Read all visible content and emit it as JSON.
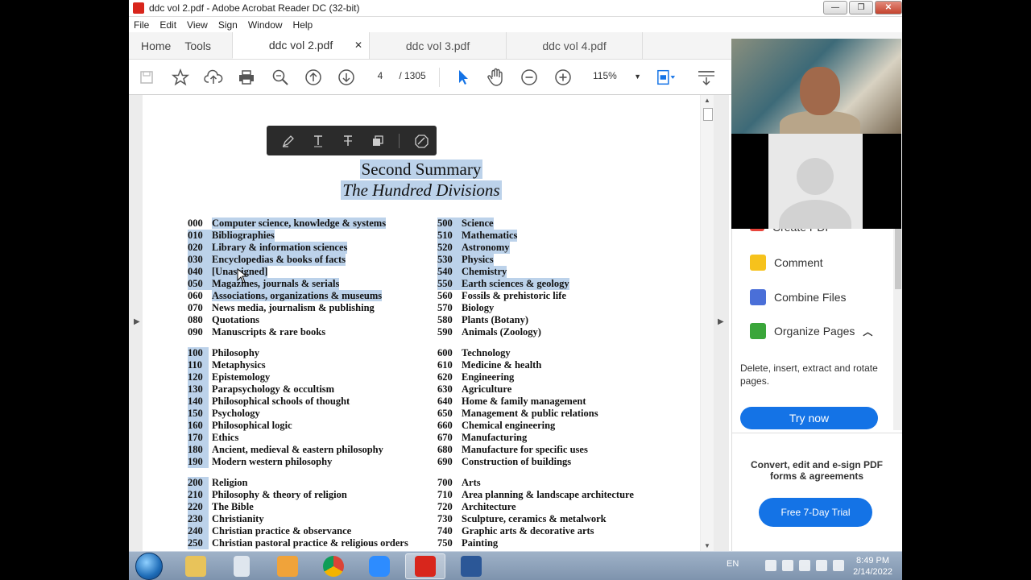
{
  "window": {
    "title": "ddc vol 2.pdf - Adobe Acrobat Reader DC (32-bit)"
  },
  "menu": [
    "File",
    "Edit",
    "View",
    "Sign",
    "Window",
    "Help"
  ],
  "tabs": {
    "home": "Home",
    "tools": "Tools",
    "docs": [
      {
        "label": "ddc vol 2.pdf",
        "active": true
      },
      {
        "label": "ddc vol 3.pdf",
        "active": false
      },
      {
        "label": "ddc vol 4.pdf",
        "active": false
      }
    ],
    "close_glyph": "✕"
  },
  "toolbar": {
    "page_current": "4",
    "page_total": "/ 1305",
    "zoom": "115%"
  },
  "document": {
    "title": "Second Summary",
    "subtitle": "The Hundred Divisions",
    "left_column": [
      {
        "code": "000",
        "label": "Computer science, knowledge & systems",
        "hl": "label"
      },
      {
        "code": "010",
        "label": "Bibliographies",
        "hl": "all"
      },
      {
        "code": "020",
        "label": "Library & information sciences",
        "hl": "all"
      },
      {
        "code": "030",
        "label": "Encyclopedias & books of facts",
        "hl": "all"
      },
      {
        "code": "040",
        "label": "[Unassigned]",
        "hl": "all"
      },
      {
        "code": "050",
        "label": "Magazines, journals & serials",
        "hl": "all"
      },
      {
        "code": "060",
        "label": "Associations, organizations & museums",
        "hl": "partial"
      },
      {
        "code": "070",
        "label": "News media, journalism & publishing",
        "hl": "none"
      },
      {
        "code": "080",
        "label": "Quotations",
        "hl": "none"
      },
      {
        "code": "090",
        "label": "Manuscripts & rare books",
        "hl": "none"
      },
      {
        "code": "100",
        "label": "Philosophy",
        "hl": "code"
      },
      {
        "code": "110",
        "label": "Metaphysics",
        "hl": "code"
      },
      {
        "code": "120",
        "label": "Epistemology",
        "hl": "code"
      },
      {
        "code": "130",
        "label": "Parapsychology & occultism",
        "hl": "code"
      },
      {
        "code": "140",
        "label": "Philosophical schools of thought",
        "hl": "code"
      },
      {
        "code": "150",
        "label": "Psychology",
        "hl": "code"
      },
      {
        "code": "160",
        "label": "Philosophical logic",
        "hl": "code"
      },
      {
        "code": "170",
        "label": "Ethics",
        "hl": "code"
      },
      {
        "code": "180",
        "label": "Ancient, medieval & eastern philosophy",
        "hl": "code"
      },
      {
        "code": "190",
        "label": "Modern western philosophy",
        "hl": "code"
      },
      {
        "code": "200",
        "label": "Religion",
        "hl": "code"
      },
      {
        "code": "210",
        "label": "Philosophy & theory of religion",
        "hl": "code"
      },
      {
        "code": "220",
        "label": "The Bible",
        "hl": "code"
      },
      {
        "code": "230",
        "label": "Christianity",
        "hl": "code"
      },
      {
        "code": "240",
        "label": "Christian practice & observance",
        "hl": "code"
      },
      {
        "code": "250",
        "label": "Christian pastoral practice & religious orders",
        "hl": "code"
      }
    ],
    "right_column": [
      {
        "code": "500",
        "label": "Science",
        "hl": "all"
      },
      {
        "code": "510",
        "label": "Mathematics",
        "hl": "all"
      },
      {
        "code": "520",
        "label": "Astronomy",
        "hl": "all"
      },
      {
        "code": "530",
        "label": "Physics",
        "hl": "all"
      },
      {
        "code": "540",
        "label": "Chemistry",
        "hl": "all"
      },
      {
        "code": "550",
        "label": "Earth sciences & geology",
        "hl": "all"
      },
      {
        "code": "560",
        "label": "Fossils & prehistoric life",
        "hl": "none"
      },
      {
        "code": "570",
        "label": "Biology",
        "hl": "none"
      },
      {
        "code": "580",
        "label": "Plants (Botany)",
        "hl": "none"
      },
      {
        "code": "590",
        "label": "Animals (Zoology)",
        "hl": "none"
      },
      {
        "code": "600",
        "label": "Technology",
        "hl": "none"
      },
      {
        "code": "610",
        "label": "Medicine & health",
        "hl": "none"
      },
      {
        "code": "620",
        "label": "Engineering",
        "hl": "none"
      },
      {
        "code": "630",
        "label": "Agriculture",
        "hl": "none"
      },
      {
        "code": "640",
        "label": "Home & family management",
        "hl": "none"
      },
      {
        "code": "650",
        "label": "Management & public relations",
        "hl": "none"
      },
      {
        "code": "660",
        "label": "Chemical engineering",
        "hl": "none"
      },
      {
        "code": "670",
        "label": "Manufacturing",
        "hl": "none"
      },
      {
        "code": "680",
        "label": "Manufacture for specific uses",
        "hl": "none"
      },
      {
        "code": "690",
        "label": "Construction of buildings",
        "hl": "none"
      },
      {
        "code": "700",
        "label": "Arts",
        "hl": "none"
      },
      {
        "code": "710",
        "label": "Area planning & landscape architecture",
        "hl": "none"
      },
      {
        "code": "720",
        "label": "Architecture",
        "hl": "none"
      },
      {
        "code": "730",
        "label": "Sculpture, ceramics & metalwork",
        "hl": "none"
      },
      {
        "code": "740",
        "label": "Graphic arts & decorative arts",
        "hl": "none"
      },
      {
        "code": "750",
        "label": "Painting",
        "hl": "none"
      }
    ]
  },
  "right_panel": {
    "create_pdf": "Create PDF",
    "comment": "Comment",
    "combine": "Combine Files",
    "organize": "Organize Pages",
    "organize_desc": "Delete, insert, extract and rotate pages.",
    "try_now": "Try now",
    "promo": "Convert, edit and e-sign PDF forms & agreements",
    "trial": "Free 7-Day Trial"
  },
  "taskbar": {
    "lang": "EN",
    "time": "8:49 PM",
    "date": "2/14/2022"
  },
  "colors": {
    "accent": "#1473e6",
    "highlight": "#bcd2ea",
    "acrobat_red": "#d8261c"
  }
}
